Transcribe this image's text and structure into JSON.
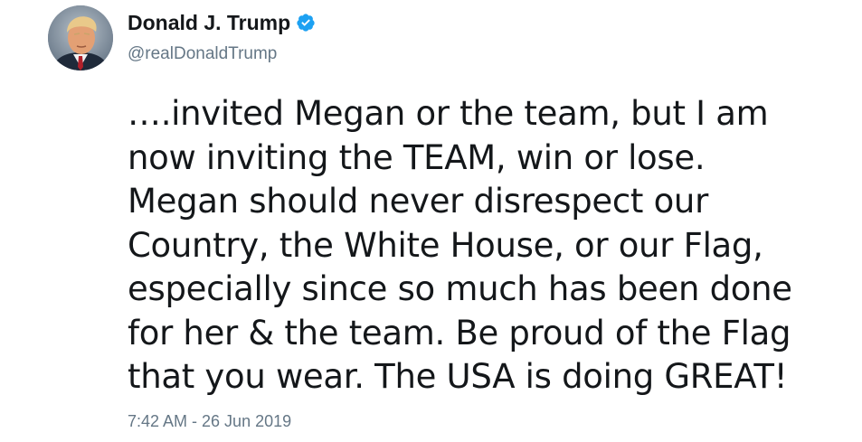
{
  "author": {
    "display_name": "Donald J. Trump",
    "handle": "@realDonaldTrump",
    "verified": true,
    "verified_icon": "verified-badge-icon",
    "verified_color": "#1da1f2"
  },
  "tweet": {
    "text": "….invited Megan or the team, but I am\nnow inviting the TEAM, win or lose.\nMegan should never disrespect our\nCountry, the White House, or our Flag,\nespecially since so much has been done\nfor her & the team. Be proud of the Flag\nthat you wear. The USA is doing GREAT!",
    "timestamp": "7:42 AM - 26 Jun 2019"
  },
  "colors": {
    "text_primary": "#14171a",
    "text_secondary": "#657786",
    "accent": "#1da1f2",
    "background": "#ffffff"
  }
}
